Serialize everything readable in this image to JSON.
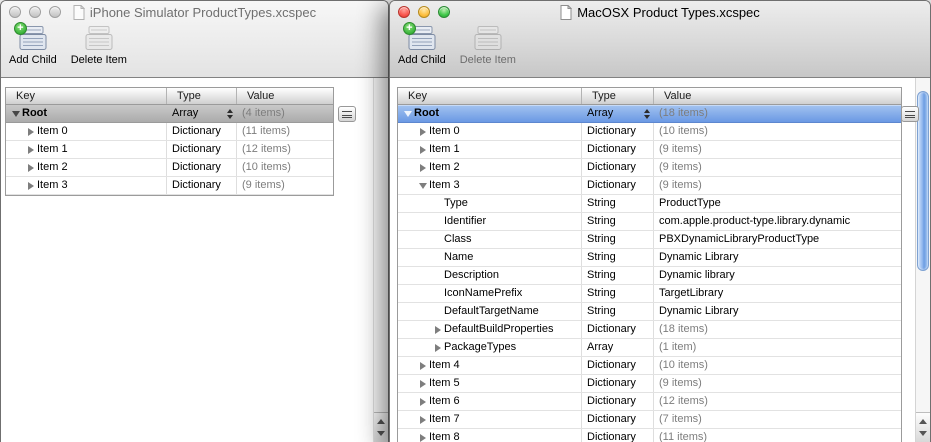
{
  "left_window": {
    "title": "iPhone Simulator ProductTypes.xcspec",
    "toolbar": {
      "add_child_label": "Add Child",
      "delete_item_label": "Delete Item"
    },
    "table": {
      "columns": [
        "Key",
        "Type",
        "Value"
      ],
      "rows": [
        {
          "key": "Root",
          "type": "Array",
          "value": "(4 items)",
          "level": 0,
          "disclosure": "expanded",
          "selected": true,
          "bold": true,
          "stepper": true
        },
        {
          "key": "Item 0",
          "type": "Dictionary",
          "value": "(11 items)",
          "level": 1,
          "disclosure": "collapsed",
          "selected": false,
          "bold": false,
          "stepper": false
        },
        {
          "key": "Item 1",
          "type": "Dictionary",
          "value": "(12 items)",
          "level": 1,
          "disclosure": "collapsed",
          "selected": false,
          "bold": false,
          "stepper": false
        },
        {
          "key": "Item 2",
          "type": "Dictionary",
          "value": "(10 items)",
          "level": 1,
          "disclosure": "collapsed",
          "selected": false,
          "bold": false,
          "stepper": false
        },
        {
          "key": "Item 3",
          "type": "Dictionary",
          "value": "(9 items)",
          "level": 1,
          "disclosure": "collapsed",
          "selected": false,
          "bold": false,
          "stepper": false
        }
      ]
    }
  },
  "right_window": {
    "title": "MacOSX Product Types.xcspec",
    "toolbar": {
      "add_child_label": "Add Child",
      "delete_item_label": "Delete Item"
    },
    "table": {
      "columns": [
        "Key",
        "Type",
        "Value"
      ],
      "rows": [
        {
          "key": "Root",
          "type": "Array",
          "value": "(18 items)",
          "level": 0,
          "disclosure": "expanded",
          "selected": true,
          "bold": true,
          "stepper": true
        },
        {
          "key": "Item 0",
          "type": "Dictionary",
          "value": "(10 items)",
          "level": 1,
          "disclosure": "collapsed",
          "selected": false,
          "bold": false,
          "stepper": false
        },
        {
          "key": "Item 1",
          "type": "Dictionary",
          "value": "(9 items)",
          "level": 1,
          "disclosure": "collapsed",
          "selected": false,
          "bold": false,
          "stepper": false
        },
        {
          "key": "Item 2",
          "type": "Dictionary",
          "value": "(9 items)",
          "level": 1,
          "disclosure": "collapsed",
          "selected": false,
          "bold": false,
          "stepper": false
        },
        {
          "key": "Item 3",
          "type": "Dictionary",
          "value": "(9 items)",
          "level": 1,
          "disclosure": "expanded",
          "selected": false,
          "bold": false,
          "stepper": false
        },
        {
          "key": "Type",
          "type": "String",
          "value": "ProductType",
          "level": 2,
          "disclosure": "none",
          "selected": false,
          "bold": false,
          "stepper": false
        },
        {
          "key": "Identifier",
          "type": "String",
          "value": "com.apple.product-type.library.dynamic",
          "level": 2,
          "disclosure": "none",
          "selected": false,
          "bold": false,
          "stepper": false
        },
        {
          "key": "Class",
          "type": "String",
          "value": "PBXDynamicLibraryProductType",
          "level": 2,
          "disclosure": "none",
          "selected": false,
          "bold": false,
          "stepper": false
        },
        {
          "key": "Name",
          "type": "String",
          "value": "Dynamic Library",
          "level": 2,
          "disclosure": "none",
          "selected": false,
          "bold": false,
          "stepper": false
        },
        {
          "key": "Description",
          "type": "String",
          "value": "Dynamic library",
          "level": 2,
          "disclosure": "none",
          "selected": false,
          "bold": false,
          "stepper": false
        },
        {
          "key": "IconNamePrefix",
          "type": "String",
          "value": "TargetLibrary",
          "level": 2,
          "disclosure": "none",
          "selected": false,
          "bold": false,
          "stepper": false
        },
        {
          "key": "DefaultTargetName",
          "type": "String",
          "value": "Dynamic Library",
          "level": 2,
          "disclosure": "none",
          "selected": false,
          "bold": false,
          "stepper": false
        },
        {
          "key": "DefaultBuildProperties",
          "type": "Dictionary",
          "value": "(18 items)",
          "level": 2,
          "disclosure": "collapsed",
          "selected": false,
          "bold": false,
          "stepper": false
        },
        {
          "key": "PackageTypes",
          "type": "Array",
          "value": "(1 item)",
          "level": 2,
          "disclosure": "collapsed",
          "selected": false,
          "bold": false,
          "stepper": false
        },
        {
          "key": "Item 4",
          "type": "Dictionary",
          "value": "(10 items)",
          "level": 1,
          "disclosure": "collapsed",
          "selected": false,
          "bold": false,
          "stepper": false
        },
        {
          "key": "Item 5",
          "type": "Dictionary",
          "value": "(9 items)",
          "level": 1,
          "disclosure": "collapsed",
          "selected": false,
          "bold": false,
          "stepper": false
        },
        {
          "key": "Item 6",
          "type": "Dictionary",
          "value": "(12 items)",
          "level": 1,
          "disclosure": "collapsed",
          "selected": false,
          "bold": false,
          "stepper": false
        },
        {
          "key": "Item 7",
          "type": "Dictionary",
          "value": "(7 items)",
          "level": 1,
          "disclosure": "collapsed",
          "selected": false,
          "bold": false,
          "stepper": false
        },
        {
          "key": "Item 8",
          "type": "Dictionary",
          "value": "(11 items)",
          "level": 1,
          "disclosure": "collapsed",
          "selected": false,
          "bold": false,
          "stepper": false
        }
      ]
    }
  },
  "colors": {
    "selection_active": "#6b99e4",
    "selection_inactive": "#ababab",
    "add_badge_green": "#39b43a",
    "scrollbar_thumb_blue": "#8fb6ee"
  },
  "icons": {
    "toolbar_item": "plist-stack-icon",
    "add_badge": "plus-badge-icon",
    "action_button": "action-menu-icon",
    "window_proxy": "document-icon",
    "add_badge_glyph": "+"
  }
}
